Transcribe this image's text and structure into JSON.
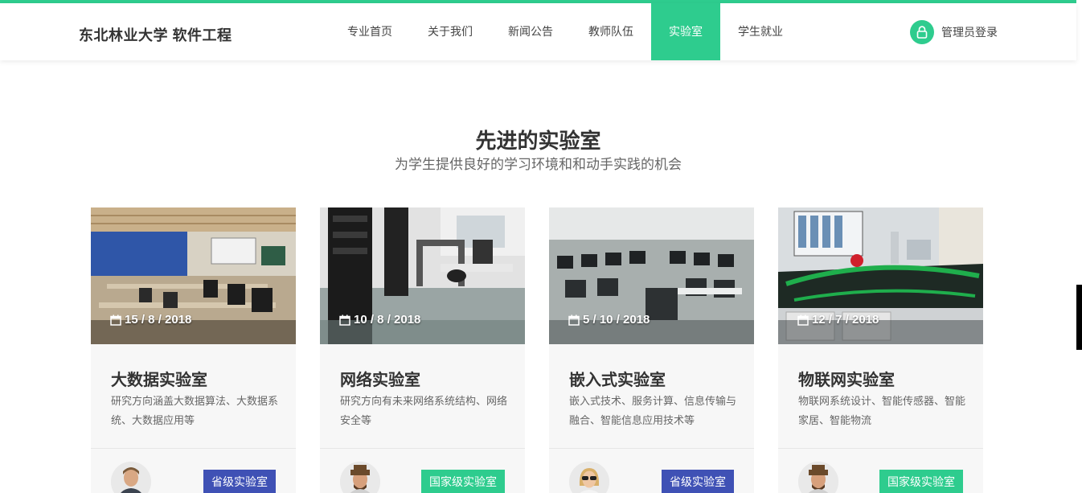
{
  "header": {
    "brand": "东北林业大学 软件工程",
    "nav": [
      {
        "label": "专业首页",
        "active": false
      },
      {
        "label": "关于我们",
        "active": false
      },
      {
        "label": "新闻公告",
        "active": false
      },
      {
        "label": "教师队伍",
        "active": false
      },
      {
        "label": "实验室",
        "active": true
      },
      {
        "label": "学生就业",
        "active": false
      }
    ],
    "login_label": "管理员登录",
    "login_icon": "lock-icon"
  },
  "section": {
    "title": "先进的实验室",
    "subtitle": "为学生提供良好的学习环境和和动手实践的机会"
  },
  "labs": [
    {
      "date": "15 / 8 / 2018",
      "title": "大数据实验室",
      "desc": "研究方向涵盖大数据算法、大数据系统、大数据应用等",
      "badge": "省级实验室",
      "badge_type": "prov"
    },
    {
      "date": "10 / 8 / 2018",
      "title": "网络实验室",
      "desc": "研究方向有未来网络系统结构、网络安全等",
      "badge": "国家级实验室",
      "badge_type": "nat"
    },
    {
      "date": "5 / 10 / 2018",
      "title": "嵌入式实验室",
      "desc": "嵌入式技术、服务计算、信息传输与融合、智能信息应用技术等",
      "badge": "省级实验室",
      "badge_type": "prov"
    },
    {
      "date": "12 / 7 / 2018",
      "title": "物联网实验室",
      "desc": "物联网系统设计、智能传感器、智能家居、智能物流",
      "badge": "国家级实验室",
      "badge_type": "nat"
    }
  ],
  "colors": {
    "accent": "#2ecc8e",
    "badge_provincial": "#3f51b5",
    "badge_national": "#2ecc8e"
  }
}
